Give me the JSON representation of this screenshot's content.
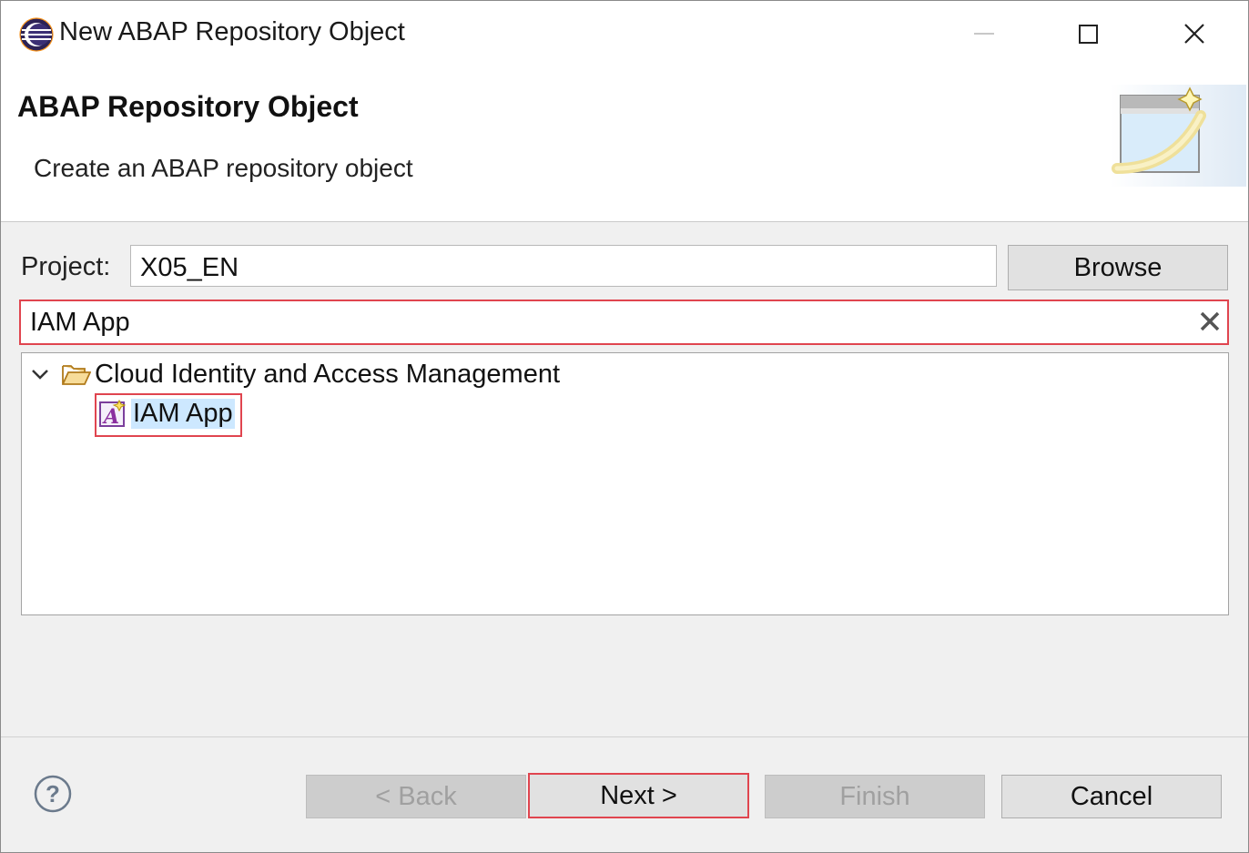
{
  "window": {
    "title": "New ABAP Repository Object",
    "icon": "eclipse-icon",
    "controls": [
      "minimize-icon",
      "maximize-icon",
      "close-icon"
    ]
  },
  "header": {
    "title": "ABAP Repository Object",
    "description": "Create an ABAP repository object",
    "banner_icon": "new-object-wizard-icon"
  },
  "project": {
    "label": "Project:",
    "value": "X05_EN",
    "browse_label": "Browse"
  },
  "filter": {
    "value": "IAM App",
    "clear_icon": "clear-x-icon"
  },
  "tree": {
    "folder": {
      "label": "Cloud Identity and Access Management",
      "expanded": true,
      "icon": "folder-open-icon"
    },
    "items": [
      {
        "label": "IAM App",
        "icon": "iam-app-icon",
        "selected": true
      }
    ]
  },
  "footer": {
    "help_icon": "help-icon",
    "back_label": "< Back",
    "next_label": "Next >",
    "finish_label": "Finish",
    "cancel_label": "Cancel"
  },
  "colors": {
    "highlight_border": "#e0454f",
    "selection_bg": "#cde8ff",
    "disabled_text": "#a0a0a0"
  }
}
